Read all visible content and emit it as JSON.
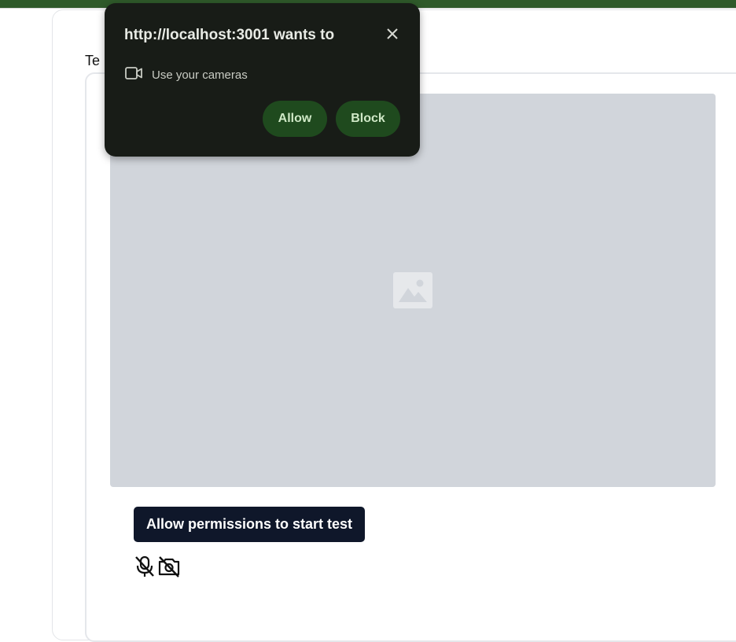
{
  "page": {
    "section_title": "Te"
  },
  "test": {
    "start_button_label": "Allow permissions to start test",
    "status_icons": [
      "mic-off-icon",
      "camera-off-icon"
    ]
  },
  "permission_popup": {
    "title": "http://localhost:3001 wants to",
    "permission_label": "Use your cameras",
    "permission_icon": "video-camera-icon",
    "allow_label": "Allow",
    "block_label": "Block",
    "close_icon": "close-icon"
  },
  "colors": {
    "top_strip": "#2f5a2a",
    "popup_background": "#181c17",
    "popup_button": "#1f4a1e",
    "placeholder": "#d1d5db",
    "start_button": "#0f172a"
  }
}
